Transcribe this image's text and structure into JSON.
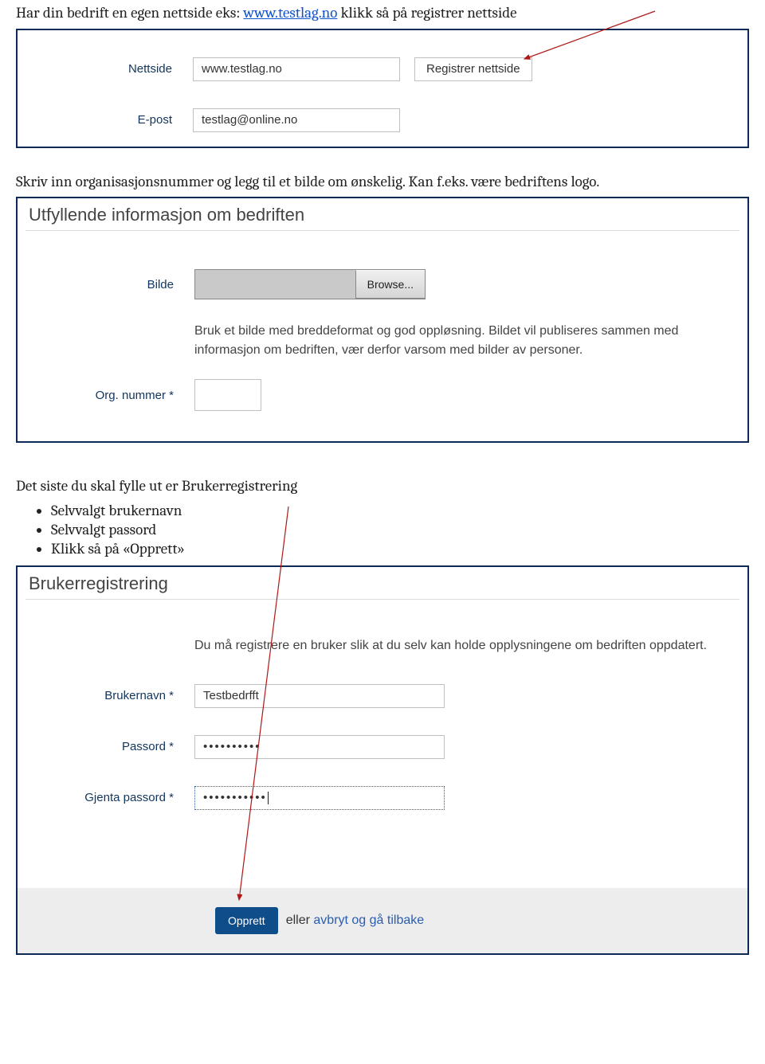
{
  "intro1_pre": "Har din bedrift en egen nettside eks: ",
  "intro1_link": "www.testlag.no",
  "intro1_post": " klikk så på registrer nettside",
  "panel1": {
    "nettside_label": "Nettside",
    "nettside_value": "www.testlag.no",
    "register_btn": "Registrer nettside",
    "epost_label": "E-post",
    "epost_value": "testlag@online.no"
  },
  "intro2": "Skriv inn organisasjonsnummer og legg til et bilde om ønskelig. Kan f.eks. være bedriftens logo.",
  "panel2": {
    "title": "Utfyllende informasjon om bedriften",
    "bilde_label": "Bilde",
    "browse": "Browse...",
    "helptext": "Bruk et bilde med breddeformat og god oppløsning. Bildet vil publiseres sammen med informasjon om bedriften, vær derfor varsom med bilder av personer.",
    "orgnr_label": "Org. nummer *"
  },
  "intro3": "Det siste du skal fylle ut er Brukerregistrering",
  "bullets": {
    "b1": "Selvvalgt brukernavn",
    "b2": "Selvvalgt passord",
    "b3": "Klikk så på «Opprett»"
  },
  "panel3": {
    "title": "Brukerregistrering",
    "helptext": "Du må registrere en bruker slik at du selv kan holde opplysningene om bedriften oppdatert.",
    "brukernavn_label": "Brukernavn *",
    "brukernavn_value": "Testbedrfft",
    "passord_label": "Passord *",
    "passord_value": "••••••••••",
    "gjenta_label": "Gjenta passord *",
    "gjenta_value": "•••••••••••",
    "opprett": "Opprett",
    "cancel_pre": " eller ",
    "cancel_link": "avbryt og gå tilbake"
  }
}
